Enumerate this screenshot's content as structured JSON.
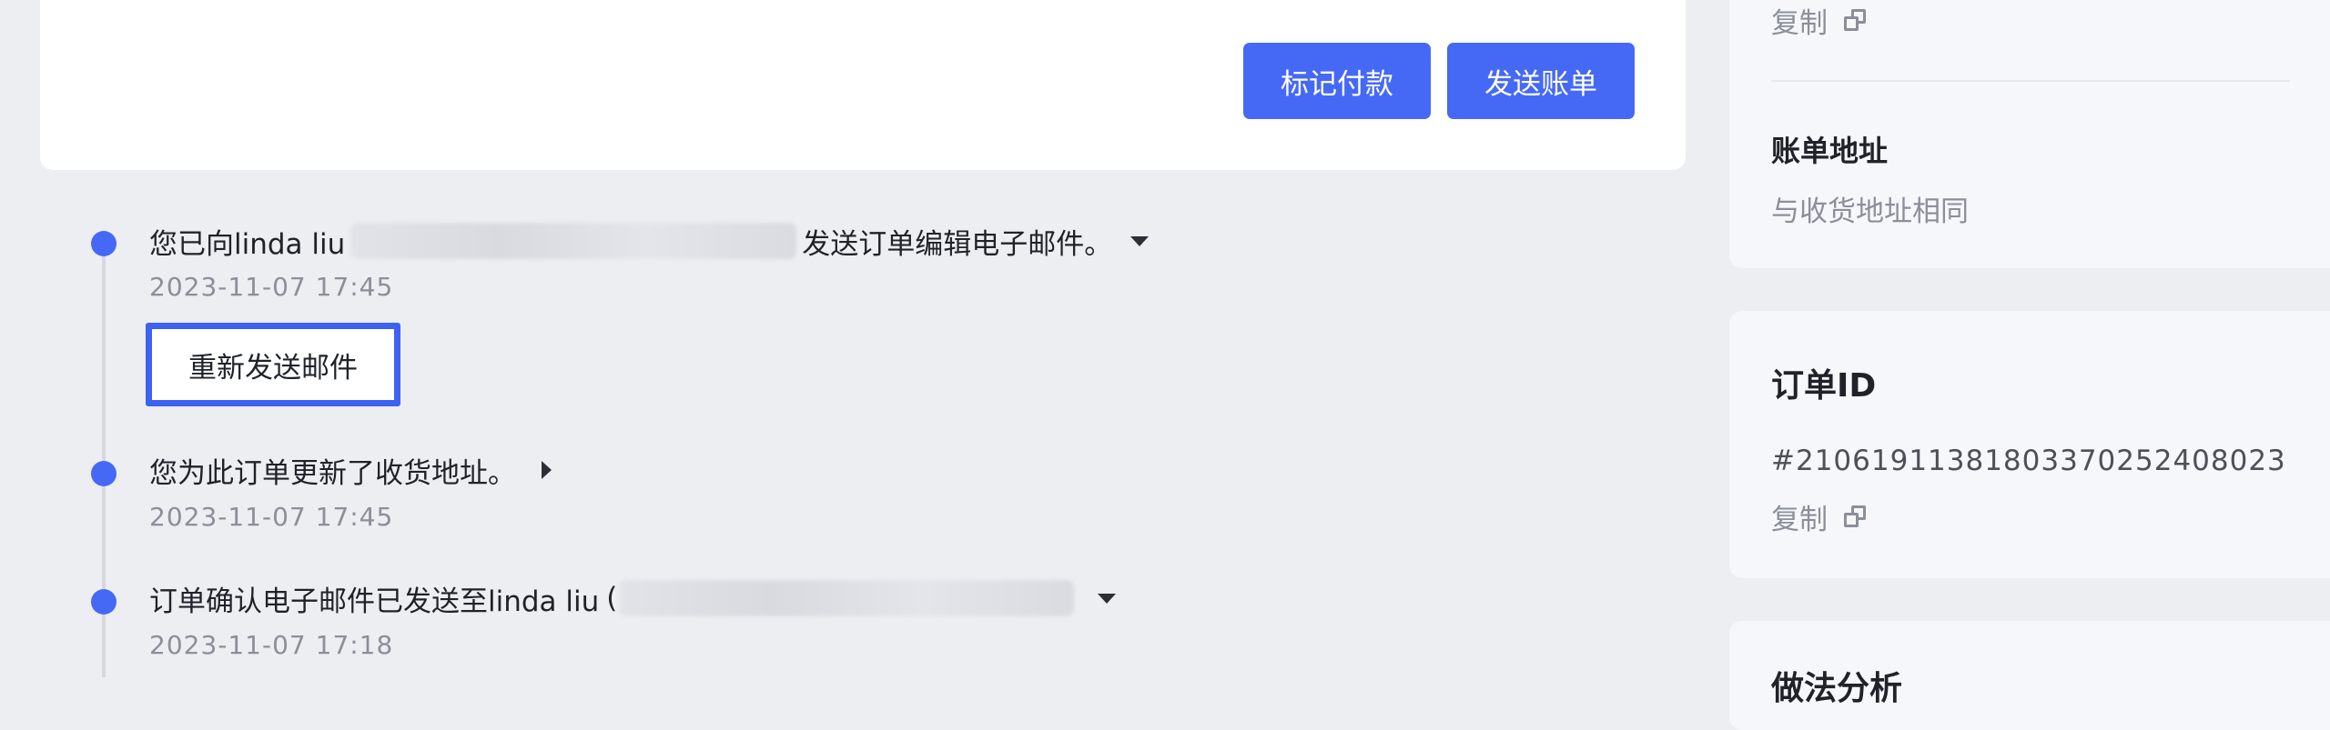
{
  "actions": {
    "mark_paid": "标记付款",
    "send_invoice": "发送账单"
  },
  "timeline": [
    {
      "text_before": "您已向linda liu",
      "blurred_email": "(luoshunxin@shoplineapp.com)",
      "text_after": "发送订单编辑电子邮件。",
      "time": "2023-11-07 17:45",
      "expand": "down",
      "button": "重新发送邮件"
    },
    {
      "text_before": "您为此订单更新了收货地址。",
      "time": "2023-11-07 17:45",
      "expand": "right"
    },
    {
      "text_before": "订单确认电子邮件已发送至linda liu",
      "paren": "(",
      "blurred_email": "luoshunxin@shoplineapp.com).",
      "time": "2023-11-07 17:18",
      "expand": "down"
    }
  ],
  "sidebar": {
    "copy_label": "复制",
    "billing_address": {
      "title": "账单地址",
      "value": "与收货地址相同"
    },
    "order_id": {
      "title": "订单ID",
      "value": "#21061911381803370252408023",
      "copy_label": "复制"
    },
    "next_title": "做法分析"
  },
  "colors": {
    "primary": "#4669f5",
    "background": "#edeef2",
    "panel": "#f6f7fa",
    "muted_text": "#8a8f99"
  }
}
